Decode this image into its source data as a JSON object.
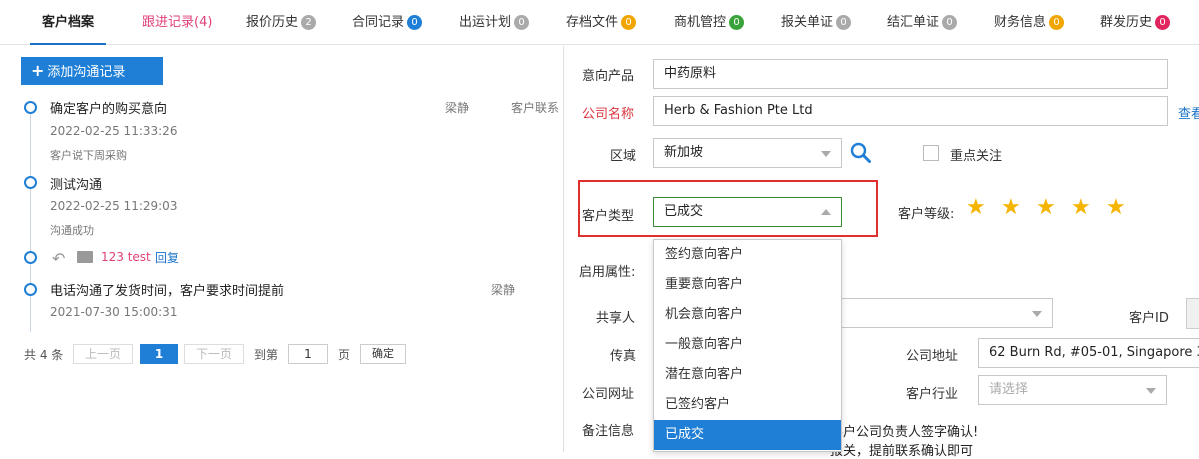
{
  "tabs": [
    {
      "label": "客户档案",
      "badge": null,
      "badge_color": null
    },
    {
      "label": "跟进记录(4)",
      "badge": null,
      "badge_color": null
    },
    {
      "label": "报价历史",
      "badge": "2",
      "badge_color": "#aaaaaa"
    },
    {
      "label": "合同记录",
      "badge": "0",
      "badge_color": "#1f7fd6"
    },
    {
      "label": "出运计划",
      "badge": "0",
      "badge_color": "#aaaaaa"
    },
    {
      "label": "存档文件",
      "badge": "0",
      "badge_color": "#f0a500"
    },
    {
      "label": "商机管控",
      "badge": "0",
      "badge_color": "#3aa23a"
    },
    {
      "label": "报关单证",
      "badge": "0",
      "badge_color": "#aaaaaa"
    },
    {
      "label": "结汇单证",
      "badge": "0",
      "badge_color": "#aaaaaa"
    },
    {
      "label": "财务信息",
      "badge": "0",
      "badge_color": "#f0a500"
    },
    {
      "label": "群发历史",
      "badge": "0",
      "badge_color": "#e0245e"
    }
  ],
  "left": {
    "add_button": "添加沟通记录",
    "timeline": [
      {
        "title": "确定客户的购买意向",
        "person": "梁静",
        "extra": "客户联系",
        "time": "2022-02-25 11:33:26",
        "note": "客户说下周采购"
      },
      {
        "title": "测试沟通",
        "person": "",
        "extra": "",
        "time": "2022-02-25 11:29:03",
        "note": "沟通成功"
      },
      {
        "reply_text": "123 test",
        "reply_link": "回复"
      },
      {
        "title": "电话沟通了发货时间，客户要求时间提前",
        "person": "梁静",
        "extra": "",
        "time": "2021-07-30 15:00:31",
        "note": ""
      }
    ],
    "pager": {
      "total": "共 4 条",
      "prev": "上一页",
      "current": "1",
      "next": "下一页",
      "goto": "到第",
      "page_input": "1",
      "page_unit": "页",
      "confirm": "确定"
    }
  },
  "form": {
    "product_label": "意向产品",
    "product_value": "中药原料",
    "company_label": "公司名称",
    "company_value": "Herb & Fashion Pte Ltd",
    "company_link": "查看",
    "region_label": "区域",
    "region_value": "新加坡",
    "focus_label": "重点关注",
    "type_label": "客户类型",
    "type_value": "已成交",
    "level_label": "客户等级:",
    "level_stars": 5,
    "enable_label": "启用属性:",
    "share_label": "共享人",
    "customer_id_label": "客户ID",
    "fax_label": "传真",
    "address_label": "公司地址",
    "address_value": "62 Burn Rd, #05-01, Singapore 3",
    "website_label": "公司网址",
    "industry_label": "客户行业",
    "industry_placeholder": "请选择",
    "remark_label": "备注信息",
    "remark_line1": "客户公司负责人签字确认!",
    "remark_line2": "报关，提前联系确认即可"
  },
  "type_options": [
    "签约意向客户",
    "重要意向客户",
    "机会意向客户",
    "一般意向客户",
    "潜在意向客户",
    "已签约客户",
    "已成交"
  ],
  "type_selected_index": 6
}
